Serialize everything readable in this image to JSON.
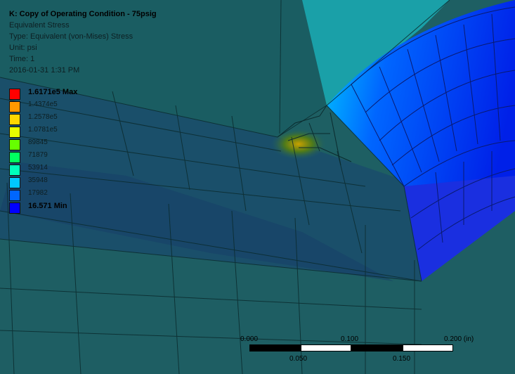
{
  "header": {
    "title": "K: Copy of Operating Condition - 75psig",
    "result_name": "Equivalent Stress",
    "result_type": "Type: Equivalent (von-Mises) Stress",
    "unit": "Unit: psi",
    "time": "Time: 1",
    "date": "2016-01-31 1:31 PM"
  },
  "legend": {
    "entries": [
      {
        "label": "1.6171e5 Max",
        "color": "#ff0000",
        "bold": true
      },
      {
        "label": "1.4374e5",
        "color": "#ff9900",
        "bold": false
      },
      {
        "label": "1.2578e5",
        "color": "#ffd700",
        "bold": false
      },
      {
        "label": "1.0781e5",
        "color": "#e8ff00",
        "bold": false
      },
      {
        "label": "89845",
        "color": "#66ff00",
        "bold": false
      },
      {
        "label": "71879",
        "color": "#00ff60",
        "bold": false
      },
      {
        "label": "53914",
        "color": "#00ffbb",
        "bold": false
      },
      {
        "label": "35948",
        "color": "#00c8ff",
        "bold": false
      },
      {
        "label": "17982",
        "color": "#0066ff",
        "bold": false
      },
      {
        "label": "16.571 Min",
        "color": "#0000ff",
        "bold": true
      }
    ]
  },
  "scale_bar": {
    "top_labels": [
      "0.000",
      "0.100",
      "0.200 (in)"
    ],
    "bottom_labels": [
      "0.050",
      "0.150"
    ]
  }
}
